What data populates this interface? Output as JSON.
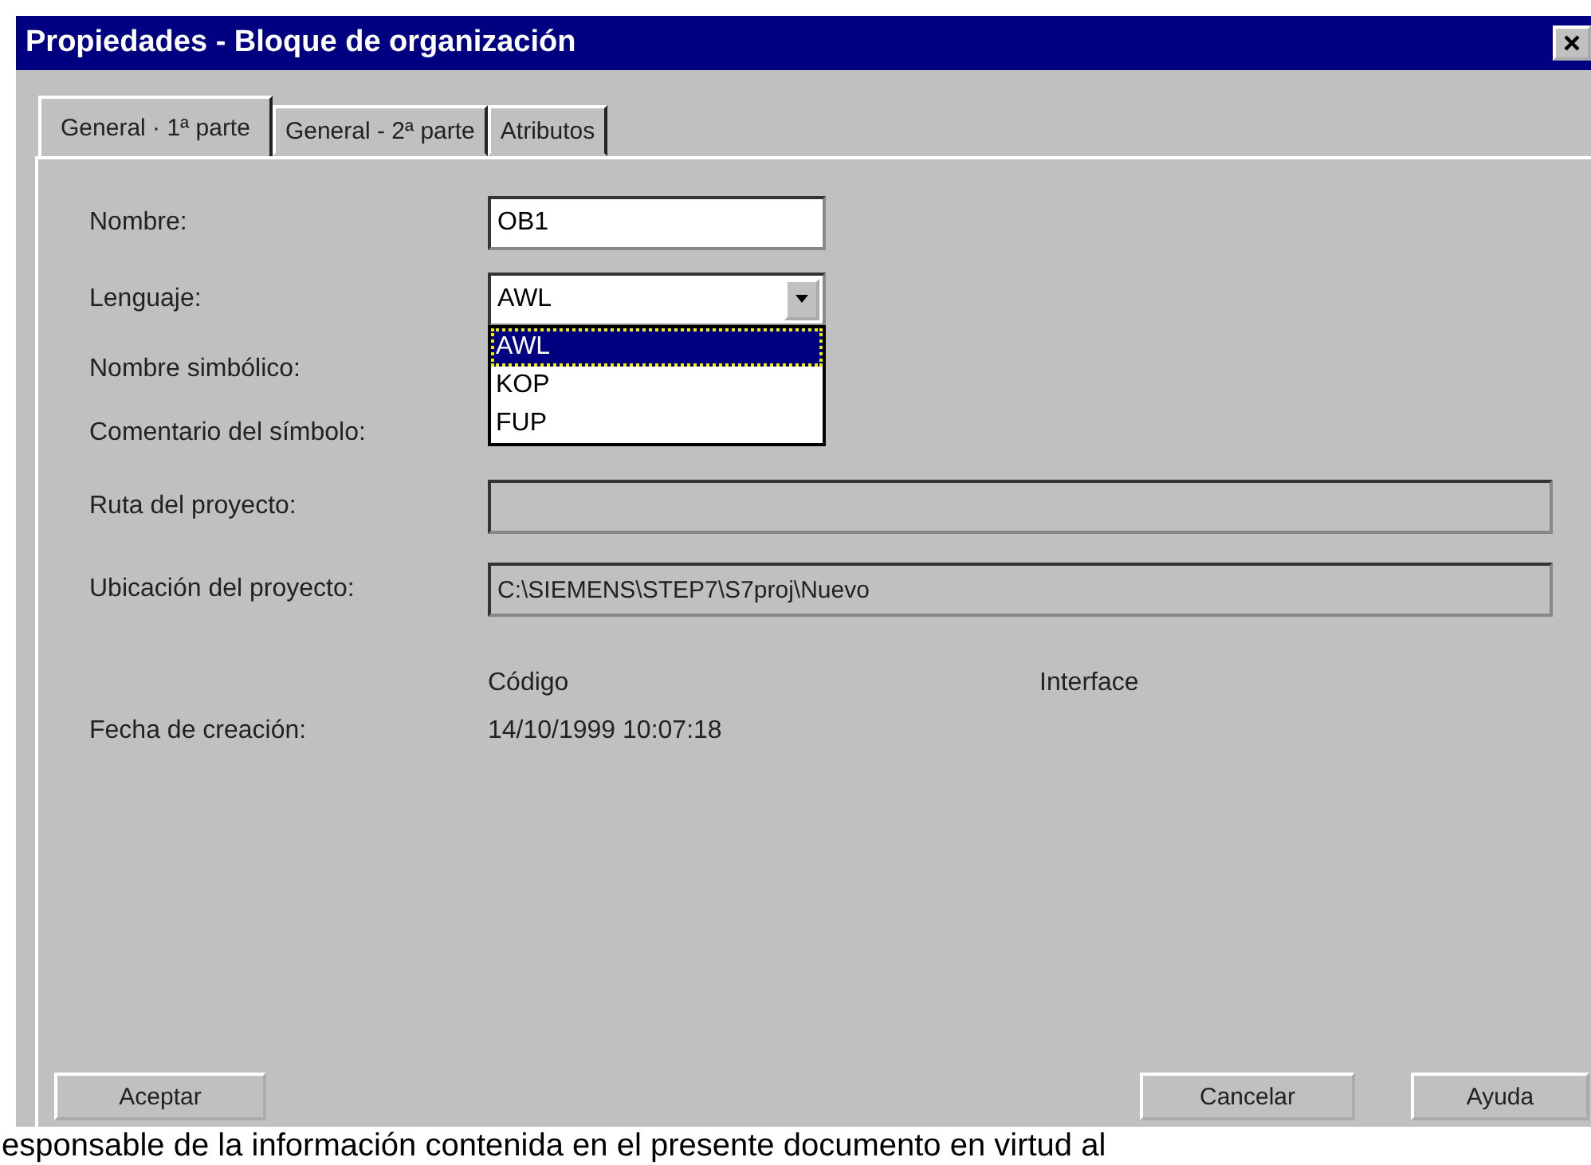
{
  "window": {
    "title": "Propiedades - Bloque de organización"
  },
  "tabs": [
    {
      "label": "General · 1ª parte",
      "selected": true
    },
    {
      "label": "General - 2ª parte",
      "selected": false
    },
    {
      "label": "Atributos",
      "selected": false
    }
  ],
  "fields": [
    {
      "kind": "text",
      "label": "Nombre:",
      "value": "OB1"
    },
    {
      "kind": "combo",
      "label": "Lenguaje:",
      "value": "AWL",
      "options": [
        {
          "label": "AWL",
          "selected": true
        },
        {
          "label": "KOP",
          "selected": false
        },
        {
          "label": "FUP",
          "selected": false
        }
      ]
    },
    {
      "kind": "covered",
      "label": "Nombre simbólico:"
    },
    {
      "kind": "covered",
      "label": "Comentario del símbolo:"
    },
    {
      "kind": "readonly",
      "label": "Ruta del proyecto:"
    },
    {
      "kind": "readonly",
      "label": "Ubicación del proyecto:",
      "value": "C:\\SIEMENS\\STEP7\\S7proj\\Nuevo"
    }
  ],
  "dates": {
    "headers": [
      "Código",
      "Interface"
    ],
    "rows": [
      {
        "label": "Fecha de creación:",
        "code": "14/10/1999  10:07:18"
      }
    ]
  },
  "buttons": [
    "Aceptar",
    "Cancelar",
    "Ayuda"
  ],
  "footer_text": "esponsable de la información contenida en el presente documento en virtud al"
}
